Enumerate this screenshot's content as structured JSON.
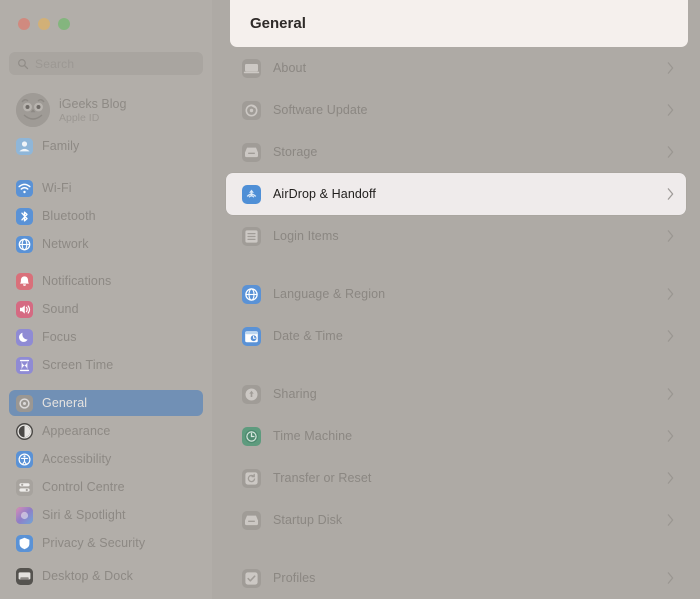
{
  "window": {
    "traffic_lights": [
      {
        "name": "close",
        "color": "#d08a7f"
      },
      {
        "name": "minimize",
        "color": "#d2b077"
      },
      {
        "name": "zoom",
        "color": "#84b57e"
      }
    ]
  },
  "search": {
    "placeholder": "Search",
    "value": "",
    "icon": "search-icon"
  },
  "account": {
    "name": "iGeeks Blog",
    "subtitle": "Apple ID",
    "avatar_icon": "owl-avatar-icon"
  },
  "sidebar": {
    "selection_color": "#7190b5",
    "groups": [
      {
        "name": "family",
        "items": [
          {
            "label": "Family",
            "icon": "family-icon",
            "color": "#8fb6d8",
            "selected": false
          }
        ]
      },
      {
        "name": "connectivity",
        "items": [
          {
            "label": "Wi-Fi",
            "icon": "wifi-icon",
            "color": "#5a92d6",
            "selected": false
          },
          {
            "label": "Bluetooth",
            "icon": "bluetooth-icon",
            "color": "#5a92d6",
            "selected": false
          },
          {
            "label": "Network",
            "icon": "network-icon",
            "color": "#5a92d6",
            "selected": false
          }
        ]
      },
      {
        "name": "alerts",
        "items": [
          {
            "label": "Notifications",
            "icon": "notifications-icon",
            "color": "#d9707a",
            "selected": false
          },
          {
            "label": "Sound",
            "icon": "sound-icon",
            "color": "#d56a82",
            "selected": false
          },
          {
            "label": "Focus",
            "icon": "focus-icon",
            "color": "#8f8bd4",
            "selected": false
          },
          {
            "label": "Screen Time",
            "icon": "screen-time-icon",
            "color": "#8f8bd4",
            "selected": false
          }
        ]
      },
      {
        "name": "system",
        "items": [
          {
            "label": "General",
            "icon": "general-gear-icon",
            "color": "#9b9792",
            "selected": true
          },
          {
            "label": "Appearance",
            "icon": "appearance-icon",
            "color": "#4a4845",
            "selected": false
          },
          {
            "label": "Accessibility",
            "icon": "accessibility-icon",
            "color": "#5a92d6",
            "selected": false
          },
          {
            "label": "Control Centre",
            "icon": "control-centre-icon",
            "color": "#a7a39e",
            "selected": false
          },
          {
            "label": "Siri & Spotlight",
            "icon": "siri-icon",
            "color": "#b96e8e",
            "selected": false
          },
          {
            "label": "Privacy & Security",
            "icon": "privacy-icon",
            "color": "#5a92d6",
            "selected": false
          }
        ]
      },
      {
        "name": "desktop",
        "items": [
          {
            "label": "Desktop & Dock",
            "icon": "desktop-dock-icon",
            "color": "#55534f",
            "selected": false
          }
        ]
      }
    ]
  },
  "main": {
    "title": "General",
    "header_bg": "#f5f0ed",
    "highlight_bg": "#efebeb",
    "chevron_icon": "chevron-right-icon",
    "sections": [
      {
        "name": "about-section",
        "rows": [
          {
            "label": "About",
            "icon": "about-icon",
            "color": "#a09c97",
            "highlighted": false
          },
          {
            "label": "Software Update",
            "icon": "software-update-icon",
            "color": "#a09c97",
            "highlighted": false
          },
          {
            "label": "Storage",
            "icon": "storage-icon",
            "color": "#a09c97",
            "highlighted": false
          }
        ]
      },
      {
        "name": "airdrop-section",
        "rows": [
          {
            "label": "AirDrop & Handoff",
            "icon": "airdrop-icon",
            "color": "#4f8fd6",
            "highlighted": true
          },
          {
            "label": "Login Items",
            "icon": "login-items-icon",
            "color": "#a09c97",
            "highlighted": false
          }
        ]
      },
      {
        "name": "locale-section",
        "rows": [
          {
            "label": "Language & Region",
            "icon": "language-region-icon",
            "color": "#5a92d6",
            "highlighted": false
          },
          {
            "label": "Date & Time",
            "icon": "date-time-icon",
            "color": "#5a92d6",
            "highlighted": false
          }
        ]
      },
      {
        "name": "sharing-section",
        "rows": [
          {
            "label": "Sharing",
            "icon": "sharing-icon",
            "color": "#a09c97",
            "highlighted": false
          },
          {
            "label": "Time Machine",
            "icon": "time-machine-icon",
            "color": "#5e9b7e",
            "highlighted": false
          },
          {
            "label": "Transfer or Reset",
            "icon": "transfer-reset-icon",
            "color": "#a09c97",
            "highlighted": false
          },
          {
            "label": "Startup Disk",
            "icon": "startup-disk-icon",
            "color": "#a09c97",
            "highlighted": false
          }
        ]
      },
      {
        "name": "profiles-section",
        "rows": [
          {
            "label": "Profiles",
            "icon": "profiles-icon",
            "color": "#a09c97",
            "highlighted": false
          }
        ]
      }
    ]
  }
}
